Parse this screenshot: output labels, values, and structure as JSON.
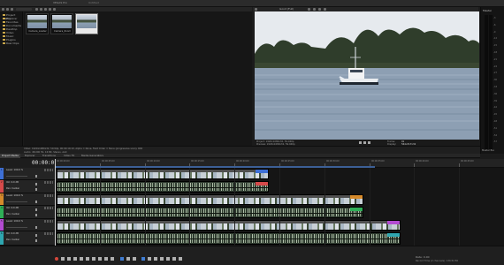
{
  "app": {
    "title": "VEGAS Pro",
    "project_name": "Untitled"
  },
  "explorer": {
    "folders": [
      "",
      "Project Media",
      "Explorer",
      "Favorites",
      "Documents",
      "Desktop",
      "Video",
      "Music",
      "Plugins",
      "Raw Clips"
    ],
    "files": [
      {
        "caption": "Camera_Loader",
        "selected": false
      },
      {
        "caption": "Camera_Zoom",
        "selected": false
      },
      {
        "caption": "",
        "selected": true
      }
    ],
    "info_line_1": "Video: 1920x1080x32, 59.94p, 00:00:10;10, Alpha = None, Field Order = None (progressive scan), PAR",
    "info_line_2": "Audio: 48,000 Hz, 16 Bit, Stereo, AAC"
  },
  "preview": {
    "quality_label": "Good (Full)",
    "project_info": "Project: 1920x1080x32, 59.940p",
    "preview_info": "Preview: 1920x1080x32, 59.940p",
    "frame_label": "Frame:",
    "frame_value": "91",
    "display_label": "Display:",
    "display_value": "564x317x32"
  },
  "meters": {
    "title": "Master",
    "scale": [
      "-3",
      "-6",
      "-9",
      "-12",
      "-15",
      "-18",
      "-21",
      "-24",
      "-27",
      "-30",
      "-33",
      "-36",
      "-39",
      "-42",
      "-45",
      "-48",
      "-51",
      "-54",
      "-57"
    ],
    "footer": "Master Bus"
  },
  "tabs": [
    "Project Media",
    "Explorer",
    "Transitions",
    "Video FX",
    "Media Generators"
  ],
  "active_tab": 0,
  "timeline": {
    "timecode": "00:00:01;05",
    "ruler_labels": [
      "00:00:00;00",
      "00:00:05;00",
      "00:00:10;00",
      "00:00:15;00",
      "00:00:20;00",
      "00:00:25;00",
      "00:00:30;00",
      "00:00:35;00",
      "00:00:40;00",
      "00:00:45;00"
    ],
    "tracks": [
      {
        "num": "1",
        "type": "video",
        "name": "Level: 100.0 %",
        "color": "#3d6fd6"
      },
      {
        "num": "2",
        "type": "audio",
        "name": "Vol: 0.0 dB",
        "sub": "Pan: Center",
        "color": "#d64a4a"
      },
      {
        "num": "3",
        "type": "video",
        "name": "Level: 100.0 %",
        "color": "#d68a2b"
      },
      {
        "num": "4",
        "type": "audio",
        "name": "Vol: 0.0 dB",
        "sub": "Pan: Center",
        "color": "#2fae57"
      },
      {
        "num": "5",
        "type": "video",
        "name": "Level: 100.0 %",
        "color": "#b24bd1"
      },
      {
        "num": "6",
        "type": "audio",
        "name": "Vol: 0.0 dB",
        "sub": "Pan: Center",
        "color": "#2fa6b0"
      }
    ]
  },
  "status": {
    "rate": "Rate: 0.00",
    "record_time": "Record Time (2 channels): 136:52:56"
  },
  "colors": {
    "accent": "#3f7cd1",
    "record": "#d4473b"
  }
}
